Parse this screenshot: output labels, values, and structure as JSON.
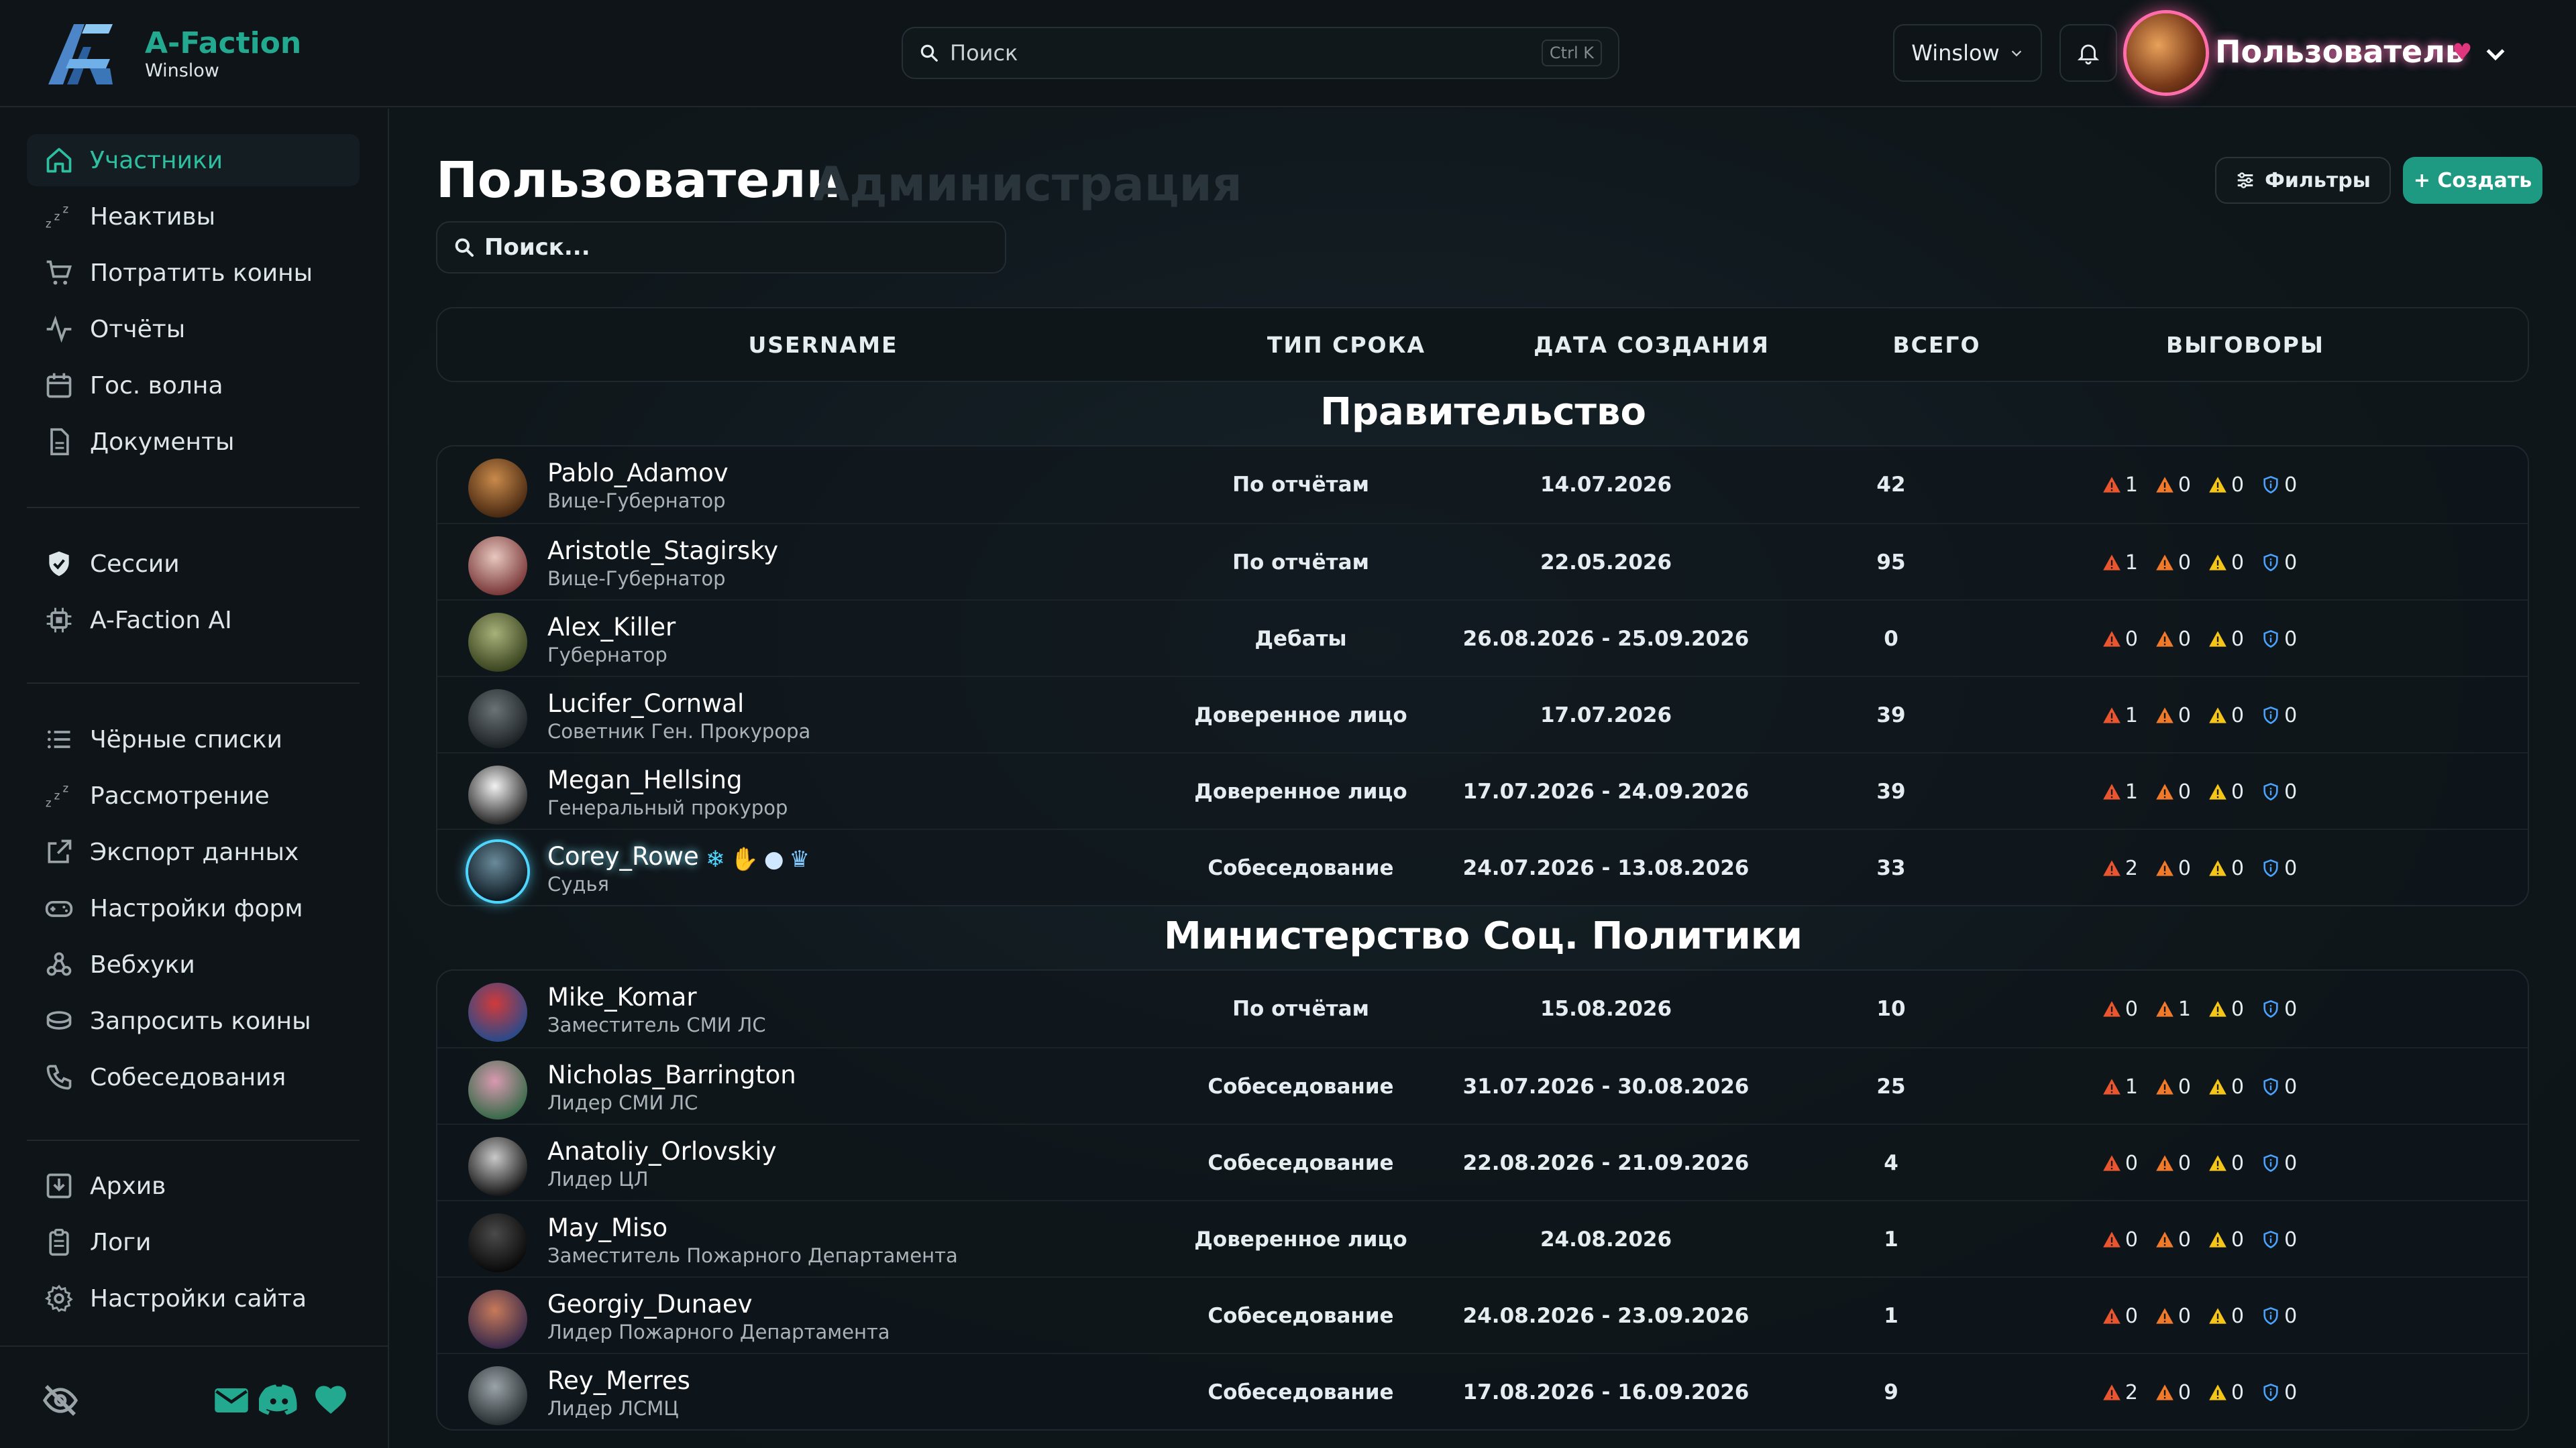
{
  "brand": {
    "name": "A-Faction",
    "server": "Winslow"
  },
  "search": {
    "placeholder": "Поиск",
    "shortcut": "Ctrl K"
  },
  "server_select": {
    "value": "Winslow"
  },
  "user": {
    "name": "Пользователь"
  },
  "sidebar": {
    "group1": [
      {
        "label": "Участники",
        "icon": "home-icon",
        "active": true
      },
      {
        "label": "Неактивы",
        "icon": "sleep-icon"
      },
      {
        "label": "Потратить коины",
        "icon": "cart-icon"
      },
      {
        "label": "Отчёты",
        "icon": "activity-icon"
      },
      {
        "label": "Гос. волна",
        "icon": "calendar-icon"
      },
      {
        "label": "Документы",
        "icon": "document-icon"
      }
    ],
    "group2": [
      {
        "label": "Сессии",
        "icon": "shield-icon"
      },
      {
        "label": "A-Faction AI",
        "icon": "chip-icon"
      }
    ],
    "group3": [
      {
        "label": "Чёрные списки",
        "icon": "list-icon"
      },
      {
        "label": "Рассмотрение",
        "icon": "sleep-icon"
      },
      {
        "label": "Экспорт данных",
        "icon": "export-icon"
      },
      {
        "label": "Настройки форм",
        "icon": "gamepad-icon"
      },
      {
        "label": "Вебхуки",
        "icon": "webhook-icon"
      },
      {
        "label": "Запросить коины",
        "icon": "coins-icon"
      },
      {
        "label": "Собеседования",
        "icon": "phone-icon"
      }
    ],
    "group4": [
      {
        "label": "Архив",
        "icon": "archive-icon"
      },
      {
        "label": "Логи",
        "icon": "clipboard-icon"
      },
      {
        "label": "Настройки сайта",
        "icon": "gear-icon"
      }
    ]
  },
  "page": {
    "title": "Пользователи",
    "subtitle": "Администрация",
    "search_placeholder": "Поиск...",
    "filters_label": "Фильтры",
    "create_label": "+ Создать"
  },
  "table": {
    "columns": [
      "USERNAME",
      "ТИП СРОКА",
      "ДАТА СОЗДАНИЯ",
      "ВСЕГО",
      "ВЫГОВОРЫ"
    ],
    "groups": [
      {
        "title": "Правительство",
        "rows": [
          {
            "name": "Pablo_Adamov",
            "role": "Вице-Губернатор",
            "type": "По отчётам",
            "date": "14.07.2026",
            "total": "42",
            "w": [
              "1",
              "0",
              "0",
              "0"
            ],
            "av": [
              "#c98a4b",
              "#4a2a12"
            ]
          },
          {
            "name": "Aristotle_Stagirsky",
            "role": "Вице-Губернатор",
            "type": "По отчётам",
            "date": "22.05.2026",
            "total": "95",
            "w": [
              "1",
              "0",
              "0",
              "0"
            ],
            "av": [
              "#e8c7c0",
              "#7a3a3a"
            ]
          },
          {
            "name": "Alex_Killer",
            "role": "Губернатор",
            "type": "Дебаты",
            "date": "26.08.2026 - 25.09.2026",
            "total": "0",
            "w": [
              "0",
              "0",
              "0",
              "0"
            ],
            "av": [
              "#a7b17a",
              "#3b4520"
            ]
          },
          {
            "name": "Lucifer_Cornwal",
            "role": "Советник Ген. Прокурора",
            "type": "Доверенное лицо",
            "date": "17.07.2026",
            "total": "39",
            "w": [
              "1",
              "0",
              "0",
              "0"
            ],
            "av": [
              "#6b7377",
              "#1d2225"
            ]
          },
          {
            "name": "Megan_Hellsing",
            "role": "Генеральный прокурор",
            "type": "Доверенное лицо",
            "date": "17.07.2026 - 24.09.2026",
            "total": "39",
            "w": [
              "1",
              "0",
              "0",
              "0"
            ],
            "av": [
              "#f2f2f2",
              "#2a2a2a"
            ]
          },
          {
            "name": "Corey_Rowe",
            "role": "Судья",
            "type": "Собеседование",
            "date": "24.07.2026 - 13.08.2026",
            "total": "33",
            "w": [
              "2",
              "0",
              "0",
              "0"
            ],
            "av": [
              "#6a8a9a",
              "#0d1a22"
            ],
            "special": true
          }
        ]
      },
      {
        "title": "Министерство Соц. Политики",
        "rows": [
          {
            "name": "Mike_Komar",
            "role": "Заместитель СМИ ЛС",
            "type": "По отчётам",
            "date": "15.08.2026",
            "total": "10",
            "w": [
              "0",
              "1",
              "0",
              "0"
            ],
            "av": [
              "#d03a3a",
              "#2a4a8a"
            ]
          },
          {
            "name": "Nicholas_Barrington",
            "role": "Лидер СМИ ЛС",
            "type": "Собеседование",
            "date": "31.07.2026 - 30.08.2026",
            "total": "25",
            "w": [
              "1",
              "0",
              "0",
              "0"
            ],
            "av": [
              "#d89ab0",
              "#3a6a4a"
            ]
          },
          {
            "name": "Anatoliy_Orlovskiy",
            "role": "Лидер ЦЛ",
            "type": "Собеседование",
            "date": "22.08.2026 - 21.09.2026",
            "total": "4",
            "w": [
              "0",
              "0",
              "0",
              "0"
            ],
            "av": [
              "#c9c9c9",
              "#1a1a1a"
            ]
          },
          {
            "name": "May_Miso",
            "role": "Заместитель Пожарного Департамента",
            "type": "Доверенное лицо",
            "date": "24.08.2026",
            "total": "1",
            "w": [
              "0",
              "0",
              "0",
              "0"
            ],
            "av": [
              "#4a4a4a",
              "#0a0a0a"
            ]
          },
          {
            "name": "Georgiy_Dunaev",
            "role": "Лидер Пожарного Департамента",
            "type": "Собеседование",
            "date": "24.08.2026 - 23.09.2026",
            "total": "1",
            "w": [
              "0",
              "0",
              "0",
              "0"
            ],
            "av": [
              "#c77a5a",
              "#3a2a4a"
            ]
          },
          {
            "name": "Rey_Merres",
            "role": "Лидер ЛСМЦ",
            "type": "Собеседование",
            "date": "17.08.2026 - 16.09.2026",
            "total": "9",
            "w": [
              "2",
              "0",
              "0",
              "0"
            ],
            "av": [
              "#9aa4a8",
              "#2a3034"
            ]
          }
        ]
      }
    ]
  },
  "colors": {
    "accent": "#23a98f",
    "warn_red": "#e8552f",
    "warn_orange": "#f07a2a",
    "warn_yellow": "#f5c518",
    "info_blue": "#4aa3ff"
  }
}
